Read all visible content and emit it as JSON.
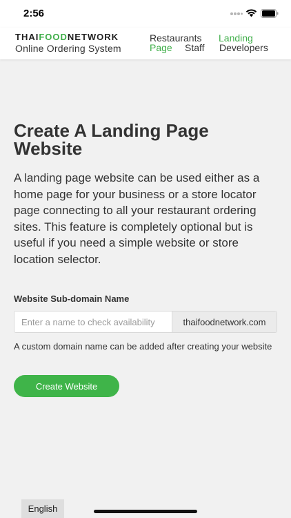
{
  "status_bar": {
    "time": "2:56"
  },
  "brand": {
    "logo_part1": "THAI",
    "logo_part2": "FOOD",
    "logo_part3": "NETWORK",
    "subtitle": "Online Ordering System"
  },
  "nav": {
    "items": [
      {
        "label": "Restaurants",
        "active": false
      },
      {
        "label": "Landing",
        "active": true
      },
      {
        "label": "Page",
        "active": true
      },
      {
        "label": "Staff",
        "active": false
      },
      {
        "label": "Developers",
        "active": false
      }
    ]
  },
  "main": {
    "title_line1": "Create A Landing Page",
    "title_line2": "Website",
    "intro": "A landing page website can be used either as a home page for your business or a store locator page connecting to all your restaurant ordering sites. This feature is completely optional but is useful if you need a simple website or store location selector.",
    "field_label": "Website Sub-domain Name",
    "input_value": "",
    "input_placeholder": "Enter a name to check availability",
    "domain_suffix": "thaifoodnetwork.com",
    "help_text": "A custom domain name can be added after creating your website",
    "create_button": "Create Website"
  },
  "footer": {
    "language_button": "English"
  },
  "colors": {
    "accent": "#3fae49",
    "button": "#3fb449",
    "background": "#f1f1f1"
  }
}
